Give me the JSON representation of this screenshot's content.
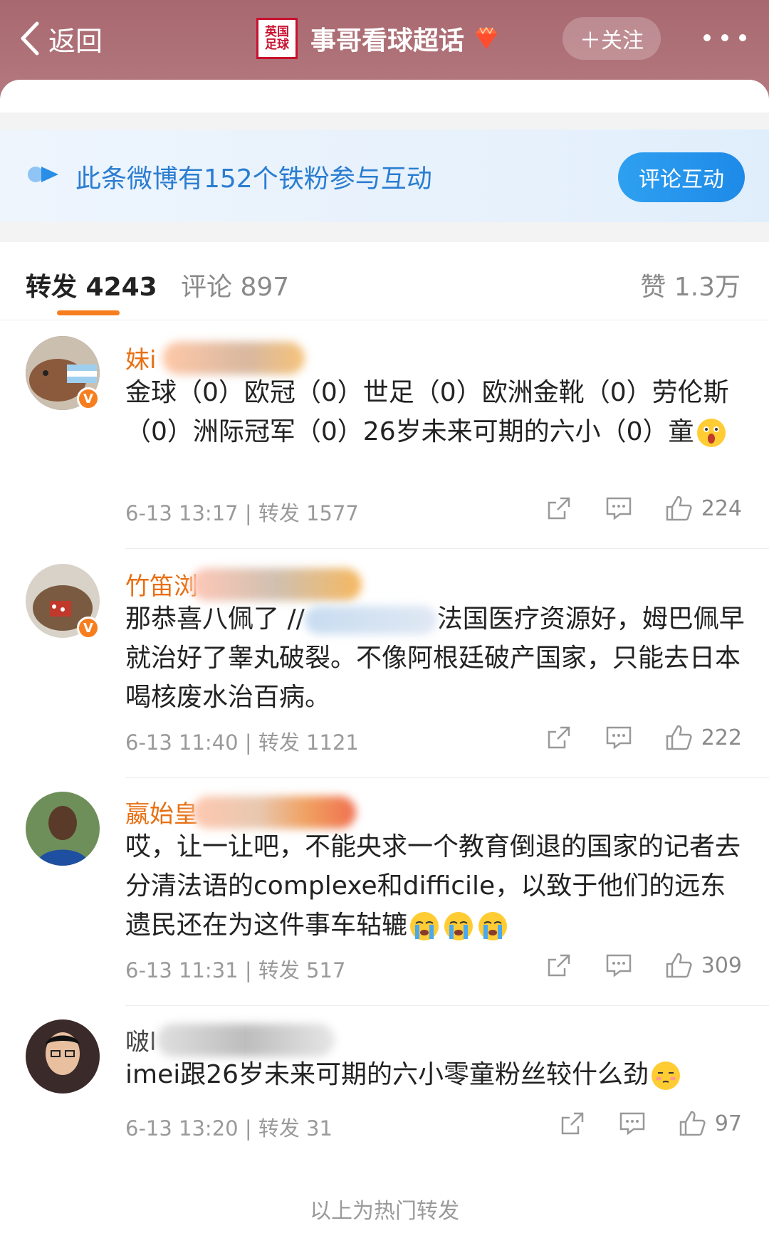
{
  "header": {
    "back_label": "返回",
    "logo_line1": "英国",
    "logo_line2": "足球",
    "title": "事哥看球超话",
    "follow_label": "＋关注"
  },
  "banner": {
    "text": "此条微博有152个铁粉参与互动",
    "button": "评论互动"
  },
  "tabs": {
    "repost": "转发 4243",
    "comment": "评论 897",
    "like": "赞 1.3万"
  },
  "reposts": [
    {
      "name": "妹i",
      "content": "金球（0）欧冠（0）世足（0）欧洲金靴（0）劳伦斯（0）洲际冠军（0）26岁未来可期的六小（0）童",
      "time": "6-13 13:17",
      "repost_count": "转发 1577",
      "likes": "224"
    },
    {
      "name": "竹笛浏",
      "content_before": "那恭喜八佩了 //",
      "content_after": "法国医疗资源好，姆巴佩早就治好了睾丸破裂。不像阿根廷破产国家，只能去日本喝核废水治百病。",
      "time": "6-13 11:40",
      "repost_count": "转发 1121",
      "likes": "222"
    },
    {
      "name": "嬴始皇",
      "content": "哎，让一让吧，不能央求一个教育倒退的国家的记者去分清法语的complexe和difficile，以致于他们的远东遗民还在为这件事车轱辘",
      "time": "6-13 11:31",
      "repost_count": "转发 517",
      "likes": "309"
    },
    {
      "name": "啵l",
      "content": "imei跟26岁未来可期的六小零童粉丝较什么劲",
      "time": "6-13 13:20",
      "repost_count": "转发 31",
      "likes": "97"
    }
  ],
  "footer_note": "以上为热门转发",
  "colors": {
    "header_bg": "#a86870",
    "accent_orange": "#f77e1f",
    "username": "#e86f12",
    "link_blue": "#2a7dd1"
  }
}
